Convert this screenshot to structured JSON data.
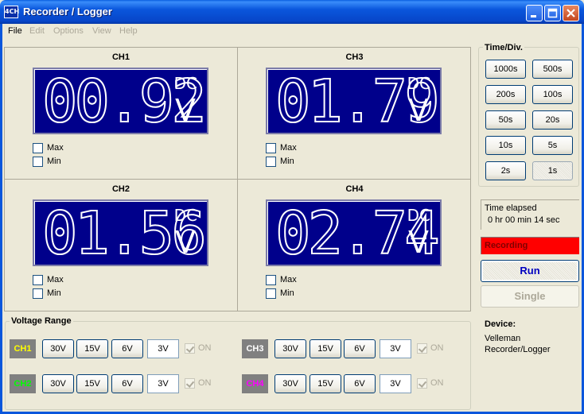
{
  "window": {
    "title": "Recorder / Logger",
    "app_icon_text": "4CH"
  },
  "menu": [
    "File",
    "Edit",
    "Options",
    "View",
    "Help"
  ],
  "channels": [
    {
      "id": "CH1",
      "value": "00.92",
      "coupling": "DC",
      "unit": "V",
      "max_label": "Max",
      "min_label": "Min"
    },
    {
      "id": "CH3",
      "value": "01.79",
      "coupling": "DC",
      "unit": "V",
      "max_label": "Max",
      "min_label": "Min"
    },
    {
      "id": "CH2",
      "value": "01.56",
      "coupling": "DC",
      "unit": "V",
      "max_label": "Max",
      "min_label": "Min"
    },
    {
      "id": "CH4",
      "value": "02.74",
      "coupling": "DC",
      "unit": "V",
      "max_label": "Max",
      "min_label": "Min"
    }
  ],
  "voltage_range": {
    "title": "Voltage Range",
    "rows": [
      {
        "tag": "CH1",
        "color": "#ffff00",
        "options": [
          "30V",
          "15V",
          "6V",
          "3V"
        ],
        "selected": "3V",
        "on_label": "ON"
      },
      {
        "tag": "CH3",
        "color": "#ffffff",
        "options": [
          "30V",
          "15V",
          "6V",
          "3V"
        ],
        "selected": "3V",
        "on_label": "ON"
      },
      {
        "tag": "CH2",
        "color": "#00ff00",
        "options": [
          "30V",
          "15V",
          "6V",
          "3V"
        ],
        "selected": "3V",
        "on_label": "ON"
      },
      {
        "tag": "CH4",
        "color": "#ff00ff",
        "options": [
          "30V",
          "15V",
          "6V",
          "3V"
        ],
        "selected": "3V",
        "on_label": "ON"
      }
    ]
  },
  "time_div": {
    "title": "Time/Div.",
    "options": [
      "1000s",
      "500s",
      "200s",
      "100s",
      "50s",
      "20s",
      "10s",
      "5s",
      "2s",
      "1s"
    ],
    "selected": "1s"
  },
  "elapsed": {
    "label": "Time elapsed",
    "value": "0 hr  00 min  14 sec"
  },
  "status": {
    "recording": "Recording",
    "recording_color": "#ff0000"
  },
  "buttons": {
    "run": "Run",
    "single": "Single"
  },
  "device": {
    "label": "Device:",
    "name": "Velleman Recorder/Logger"
  }
}
